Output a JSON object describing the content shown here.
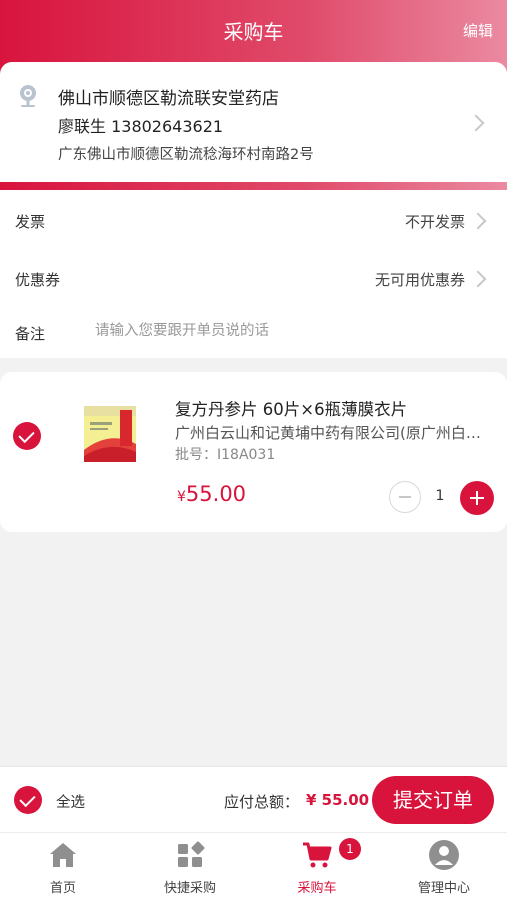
{
  "header": {
    "title": "采购车",
    "edit_label": "编辑"
  },
  "address": {
    "store_name": "佛山市顺德区勒流联安堂药店",
    "contact": "廖联生 13802643621",
    "detail": "广东佛山市顺德区勒流稔海环村南路2号"
  },
  "options": {
    "invoice_label": "发票",
    "invoice_value": "不开发票",
    "coupon_label": "优惠券",
    "coupon_value": "无可用优惠券",
    "remark_label": "备注",
    "remark_placeholder": "请输入您要跟开单员说的话",
    "remark_value": ""
  },
  "cart_item": {
    "name": "复方丹参片 60片×6瓶薄膜衣片",
    "manufacturer": "广州白云山和记黄埔中药有限公司(原广州白云山中药厂)",
    "batch": "批号：I18A031",
    "currency": "¥",
    "price": "55.00",
    "quantity": "1",
    "checked": true
  },
  "checkout": {
    "select_all_label": "全选",
    "total_label": "应付总额：",
    "total_amount": "¥ 55.00",
    "submit_label": "提交订单"
  },
  "tabbar": {
    "items": [
      {
        "label": "首页",
        "icon": "home-icon"
      },
      {
        "label": "快捷采购",
        "icon": "grid-icon"
      },
      {
        "label": "采购车",
        "icon": "cart-icon",
        "active": true,
        "badge": "1"
      },
      {
        "label": "管理中心",
        "icon": "user-icon"
      }
    ]
  },
  "colors": {
    "accent": "#d8143d",
    "background": "#f2f2f2"
  }
}
